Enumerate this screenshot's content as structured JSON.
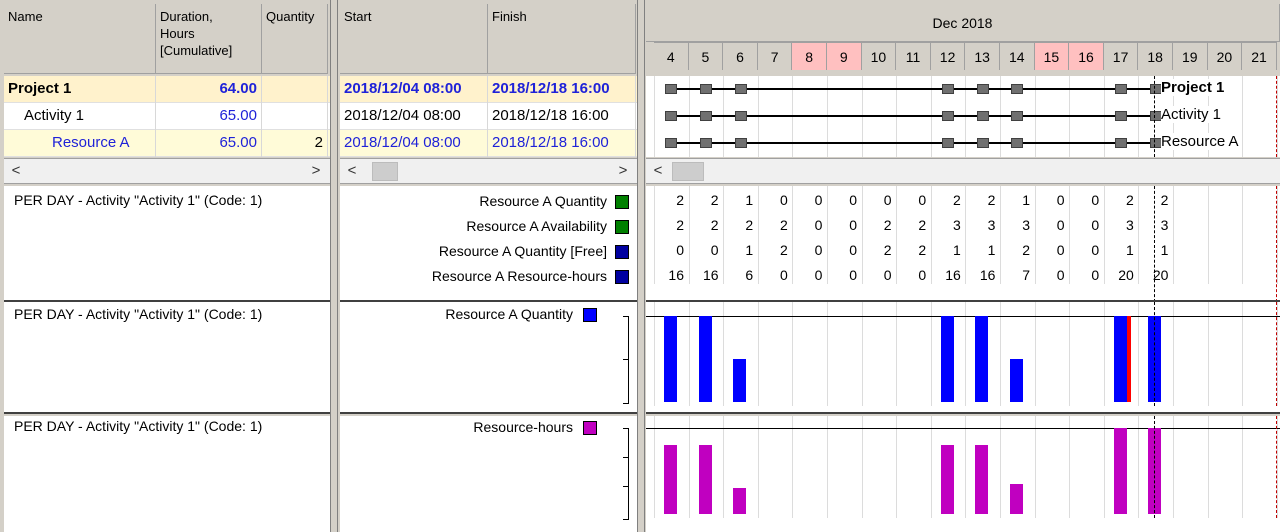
{
  "columns": {
    "name": "Name",
    "duration": "Duration,\nHours\n[Cumulative]",
    "quantity": "Quantity",
    "start": "Start",
    "finish": "Finish"
  },
  "timescale": {
    "month": "Dec 2018",
    "days": [
      "4",
      "5",
      "6",
      "7",
      "8",
      "9",
      "10",
      "11",
      "12",
      "13",
      "14",
      "15",
      "16",
      "17",
      "18",
      "19",
      "20",
      "21"
    ],
    "weekend_days": [
      "8",
      "9",
      "15",
      "16"
    ],
    "weekend_color": "#ffc0c0"
  },
  "rows": [
    {
      "name": "Project 1",
      "duration": "64.00",
      "quantity": "",
      "start": "2018/12/04  08:00",
      "finish": "2018/12/18  16:00",
      "gantt_label": "Project 1"
    },
    {
      "name": "Activity 1",
      "duration": "65.00",
      "quantity": "",
      "start": "2018/12/04  08:00",
      "finish": "2018/12/18  16:00",
      "gantt_label": "Activity 1"
    },
    {
      "name": "Resource A",
      "duration": "65.00",
      "quantity": "2",
      "start": "2018/12/04  08:00",
      "finish": "2018/12/18  16:00",
      "gantt_label": "Resource A"
    }
  ],
  "scroll": {
    "left": "<",
    "right": ">"
  },
  "histograms": [
    {
      "title": "PER DAY - Activity \"Activity 1\" (Code: 1)",
      "series": [
        {
          "label": "Resource A Quantity",
          "color": "#008000",
          "values": [
            "2",
            "2",
            "1",
            "0",
            "0",
            "0",
            "0",
            "0",
            "2",
            "2",
            "1",
            "0",
            "0",
            "2",
            "2"
          ]
        },
        {
          "label": "Resource A Availability",
          "color": "#008000",
          "values": [
            "2",
            "2",
            "2",
            "2",
            "0",
            "0",
            "2",
            "2",
            "3",
            "3",
            "3",
            "0",
            "0",
            "3",
            "3"
          ]
        },
        {
          "label": "Resource A Quantity [Free]",
          "color": "#0000a0",
          "values": [
            "0",
            "0",
            "1",
            "2",
            "0",
            "0",
            "2",
            "2",
            "1",
            "1",
            "2",
            "0",
            "0",
            "1",
            "1"
          ]
        },
        {
          "label": "Resource A Resource-hours",
          "color": "#0000a0",
          "values": [
            "16",
            "16",
            "6",
            "0",
            "0",
            "0",
            "0",
            "0",
            "16",
            "16",
            "7",
            "0",
            "0",
            "20",
            "20"
          ]
        }
      ]
    },
    {
      "title": "PER DAY - Activity \"Activity 1\" (Code: 1)",
      "legend": "Resource A Quantity",
      "color": "#0000ff",
      "values": [
        2,
        2,
        1,
        0,
        0,
        0,
        0,
        0,
        2,
        2,
        1,
        0,
        0,
        2,
        2
      ],
      "max": 2
    },
    {
      "title": "PER DAY - Activity \"Activity 1\" (Code: 1)",
      "legend": "Resource-hours",
      "color": "#c000c0",
      "values": [
        16,
        16,
        6,
        0,
        0,
        0,
        0,
        0,
        16,
        16,
        7,
        0,
        0,
        20,
        20
      ],
      "max": 20
    }
  ],
  "colors": {
    "summary_row": "#fff2cc",
    "link_blue": "#1f22d8"
  }
}
